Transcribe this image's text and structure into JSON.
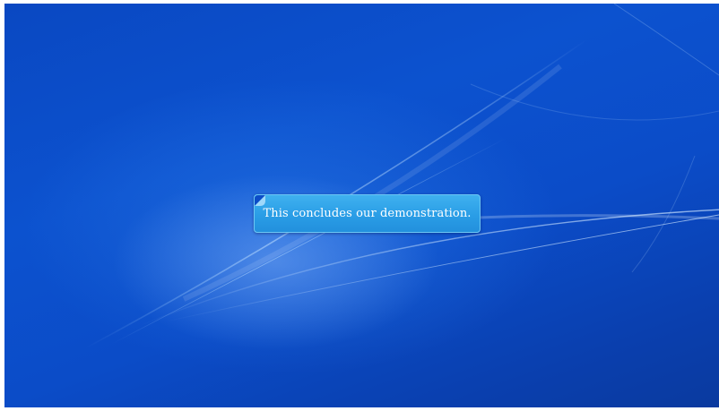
{
  "desktop": {
    "wallpaper": "windows-7-blue-wallpaper",
    "background_color": "#0b4cc8"
  },
  "callout": {
    "text": "This concludes our demonstration.",
    "background_color": "#2a9de6",
    "border_color": "#6cc7f5",
    "text_color": "#ffffff"
  }
}
